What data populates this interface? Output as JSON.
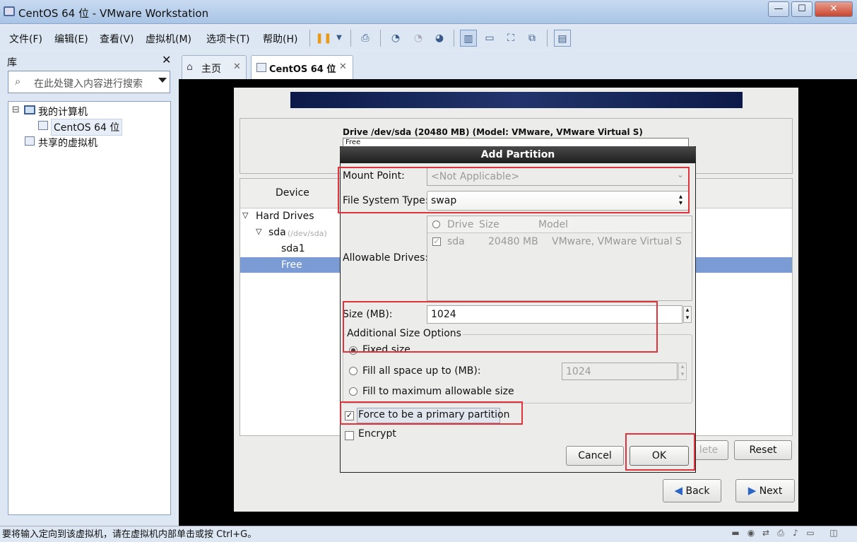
{
  "window": {
    "title": "CentOS 64 位 - VMware Workstation",
    "min": "—",
    "max": "☐",
    "close": "✕"
  },
  "menu": [
    "文件(F)",
    "编辑(E)",
    "查看(V)",
    "虚拟机(M)",
    "选项卡(T)",
    "帮助(H)"
  ],
  "library": {
    "title": "库",
    "close": "✕",
    "search_placeholder": "在此处键入内容进行搜索",
    "tree": {
      "root": "我的计算机",
      "vm": "CentOS 64 位",
      "shared": "共享的虚拟机",
      "expander": "⊟"
    }
  },
  "tabs": [
    {
      "label": "主页",
      "close": "✕"
    },
    {
      "label": "CentOS 64 位",
      "close": "✕"
    }
  ],
  "installer": {
    "drive_title": "Drive /dev/sda (20480 MB) (Model: VMware, VMware Virtual S)",
    "drive_free": "Free",
    "device_header": "Device",
    "tree": {
      "hard_drives": "Hard Drives",
      "sda": "sda",
      "sda_path": "(/dev/sda)",
      "sda1": "sda1",
      "free": "Free"
    },
    "buttons": {
      "delete_partial": "lete",
      "reset": "Reset",
      "back": "Back",
      "next": "Next"
    }
  },
  "dialog": {
    "title": "Add Partition",
    "mount_point_label": "Mount Point:",
    "mount_point_value": "<Not Applicable>",
    "fs_type_label": "File System Type:",
    "fs_type_value": "swap",
    "allowable_drives_label": "Allowable Drives:",
    "drives_columns": [
      "Drive",
      "Size",
      "Model"
    ],
    "drives_rows": [
      {
        "drive": "sda",
        "size": "20480 MB",
        "model": "VMware, VMware Virtual S",
        "checked": true
      }
    ],
    "size_label": "Size (MB):",
    "size_value": "1024",
    "additional_size_options": "Additional Size Options",
    "fixed_size": "Fixed size",
    "fill_up_to": "Fill all space up to (MB):",
    "fill_up_to_value": "1024",
    "fill_max": "Fill to maximum allowable size",
    "force_primary": "Force to be a primary partition",
    "encrypt": "Encrypt",
    "cancel": "Cancel",
    "ok": "OK",
    "force_primary_checked": true,
    "encrypt_checked": false,
    "selected_size_option": "Fixed size"
  },
  "status": {
    "message": "要将输入定向到该虚拟机，请在虚拟机内部单击或按 Ctrl+G。"
  },
  "colors": {
    "highlight": "#e0333b",
    "selection": "#7a9bd4",
    "dialog_title_bg": "#1e1e1e"
  }
}
